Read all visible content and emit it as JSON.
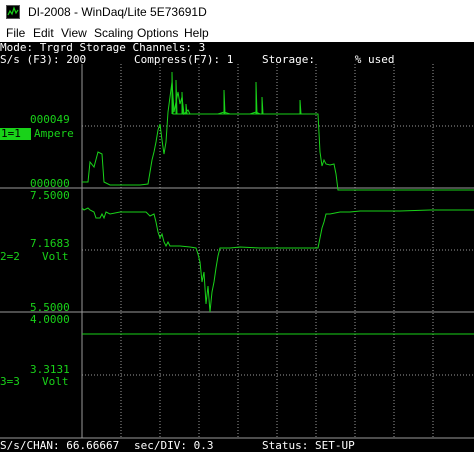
{
  "window": {
    "title": "DI-2008 - WinDaq/Lite 5E73691D"
  },
  "menu": [
    "File",
    "Edit",
    "View",
    "Scaling",
    "Options",
    "Help"
  ],
  "status_top": {
    "mode": "Mode: Trgrd Storage Channels: 3",
    "rate": "S/s (F3): 200",
    "compress": "Compress(F7): 1",
    "storage": "Storage:      % used"
  },
  "channels": [
    {
      "id": "1=1",
      "unit": "Ampere",
      "top_value": "000049",
      "bottom_value": "000000",
      "top_ext": ""
    },
    {
      "id": "2=2",
      "unit": "Volt",
      "top_value": "7.5000",
      "mid_value": "7.1683",
      "bottom_value": "5.5000"
    },
    {
      "id": "3=3",
      "unit": "Volt",
      "top_value": "4.0000",
      "mid_value": "3.3131"
    }
  ],
  "status_bottom": {
    "rate": "S/s/CHAN: 66.66667",
    "div": "sec/DIV: 0.3",
    "status": "Status: SET-UP"
  },
  "colors": {
    "trace": "#19d219",
    "grid": "#9a9a9a",
    "background": "#000000",
    "text": "#ffffff"
  }
}
